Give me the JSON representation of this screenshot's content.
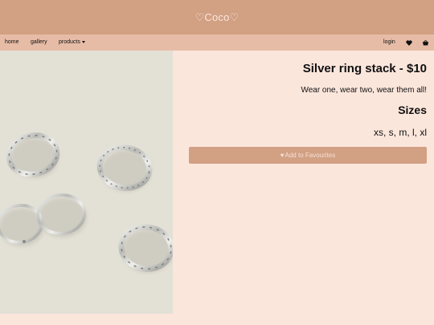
{
  "header": {
    "brand": "♡Coco♡"
  },
  "nav": {
    "home": "home",
    "gallery": "gallery",
    "products": "products",
    "login": "login",
    "icons": [
      "heart-icon",
      "shopping-bag-icon"
    ]
  },
  "product": {
    "title": "Silver ring stack - $10",
    "description": "Wear one, wear two, wear them all!",
    "sizes_heading": "Sizes",
    "sizes": "xs, s, m, l, xl",
    "favourite_button": "Add to Favourites",
    "image_icon": "silver-rings-image"
  },
  "colors": {
    "header": "#d2a083",
    "navbar": "#e7bca6",
    "background": "#fbe6dc",
    "button": "#d2a083"
  }
}
